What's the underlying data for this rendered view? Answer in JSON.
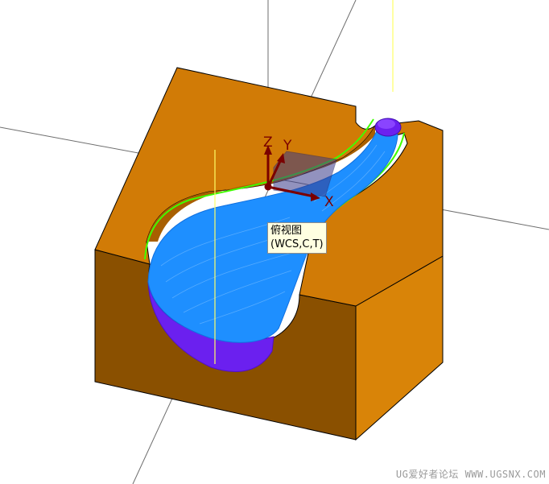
{
  "viewport": {
    "background": "#ffffff",
    "part_colors": {
      "block_top": "#d17b06",
      "block_front": "#8a5000",
      "block_right": "#d98408",
      "toolpath_primary": "#1e8fff",
      "toolpath_secondary": "#6b20ef",
      "edge_highlight": "#3fff00",
      "tool_axis": "#ffff66"
    }
  },
  "wcs": {
    "axis_labels": {
      "z": "Z",
      "y": "Y",
      "x": "X"
    },
    "axis_color": "#7a0000"
  },
  "tooltip": {
    "line1": "俯视图",
    "line2": "(WCS,C,T)"
  },
  "watermark": {
    "text": "UG爱好者论坛 WWW.UGSNX.COM"
  }
}
